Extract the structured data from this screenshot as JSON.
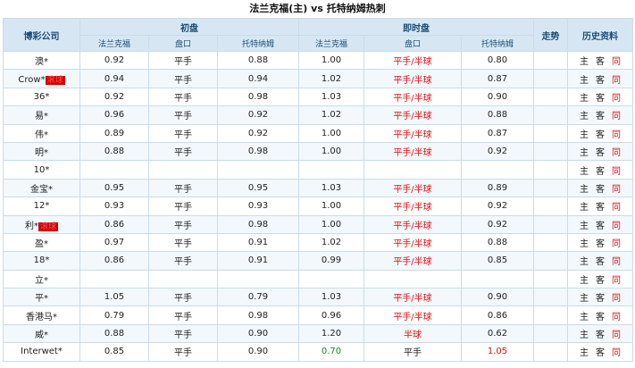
{
  "title": "法兰克福(主) vs 托特纳姆热刺",
  "headers": {
    "company": "博彩公司",
    "initial": "初盘",
    "live": "即时盘",
    "trend": "走势",
    "history": "历史资料",
    "home": "法兰克福",
    "handicap": "盘口",
    "away": "托特纳姆"
  },
  "history_labels": {
    "home": "主",
    "guest": "客",
    "same": "同"
  },
  "colors": {
    "header_bg": "#d6e7f3",
    "border": "#c9dce8",
    "red": "#e01010",
    "green": "#1a8a1a"
  },
  "rows": [
    {
      "company": "澳*",
      "tag": "",
      "h1": "0.92",
      "p1": "平手",
      "a1": "0.88",
      "h2": "1.00",
      "p2": "平手/半球",
      "a2": "0.80"
    },
    {
      "company": "Crow*",
      "tag": "滚球",
      "h1": "0.94",
      "p1": "平手",
      "a1": "0.94",
      "h2": "1.02",
      "p2": "平手/半球",
      "a2": "0.87"
    },
    {
      "company": "36*",
      "tag": "",
      "h1": "0.92",
      "p1": "平手",
      "a1": "0.98",
      "h2": "1.03",
      "p2": "平手/半球",
      "a2": "0.90"
    },
    {
      "company": "易*",
      "tag": "",
      "h1": "0.96",
      "p1": "平手",
      "a1": "0.92",
      "h2": "1.02",
      "p2": "平手/半球",
      "a2": "0.88"
    },
    {
      "company": "伟*",
      "tag": "",
      "h1": "0.89",
      "p1": "平手",
      "a1": "0.92",
      "h2": "1.00",
      "p2": "平手/半球",
      "a2": "0.87"
    },
    {
      "company": "明*",
      "tag": "",
      "h1": "0.88",
      "p1": "平手",
      "a1": "0.98",
      "h2": "1.00",
      "p2": "平手/半球",
      "a2": "0.92"
    },
    {
      "company": "10*",
      "tag": "",
      "h1": "",
      "p1": "",
      "a1": "",
      "h2": "",
      "p2": "",
      "a2": ""
    },
    {
      "company": "金宝*",
      "tag": "",
      "h1": "0.95",
      "p1": "平手",
      "a1": "0.95",
      "h2": "1.03",
      "p2": "平手/半球",
      "a2": "0.89"
    },
    {
      "company": "12*",
      "tag": "",
      "h1": "0.93",
      "p1": "平手",
      "a1": "0.93",
      "h2": "1.00",
      "p2": "平手/半球",
      "a2": "0.92"
    },
    {
      "company": "利*",
      "tag": "滚球",
      "h1": "0.86",
      "p1": "平手",
      "a1": "0.98",
      "h2": "1.00",
      "p2": "平手/半球",
      "a2": "0.92"
    },
    {
      "company": "盈*",
      "tag": "",
      "h1": "0.97",
      "p1": "平手",
      "a1": "0.91",
      "h2": "1.02",
      "p2": "平手/半球",
      "a2": "0.88"
    },
    {
      "company": "18*",
      "tag": "",
      "h1": "0.86",
      "p1": "平手",
      "a1": "0.91",
      "h2": "0.99",
      "p2": "平手/半球",
      "a2": "0.85"
    },
    {
      "company": "立*",
      "tag": "",
      "h1": "",
      "p1": "",
      "a1": "",
      "h2": "",
      "p2": "",
      "a2": ""
    },
    {
      "company": "平*",
      "tag": "",
      "h1": "1.05",
      "p1": "平手",
      "a1": "0.79",
      "h2": "1.03",
      "p2": "平手/半球",
      "a2": "0.90"
    },
    {
      "company": "香港马*",
      "tag": "",
      "h1": "0.79",
      "p1": "平手",
      "a1": "0.98",
      "h2": "0.96",
      "p2": "平手/半球",
      "a2": "0.86"
    },
    {
      "company": "威*",
      "tag": "",
      "h1": "0.88",
      "p1": "平手",
      "a1": "0.90",
      "h2": "1.20",
      "p2": "半球",
      "a2": "0.62"
    },
    {
      "company": "Interwet*",
      "tag": "",
      "h1": "0.85",
      "p1": "平手",
      "a1": "0.90",
      "h2": "0.70",
      "p2": "平手",
      "a2": "1.05",
      "h2_color": "green",
      "p2_color": "black",
      "a2_color": "red"
    }
  ]
}
